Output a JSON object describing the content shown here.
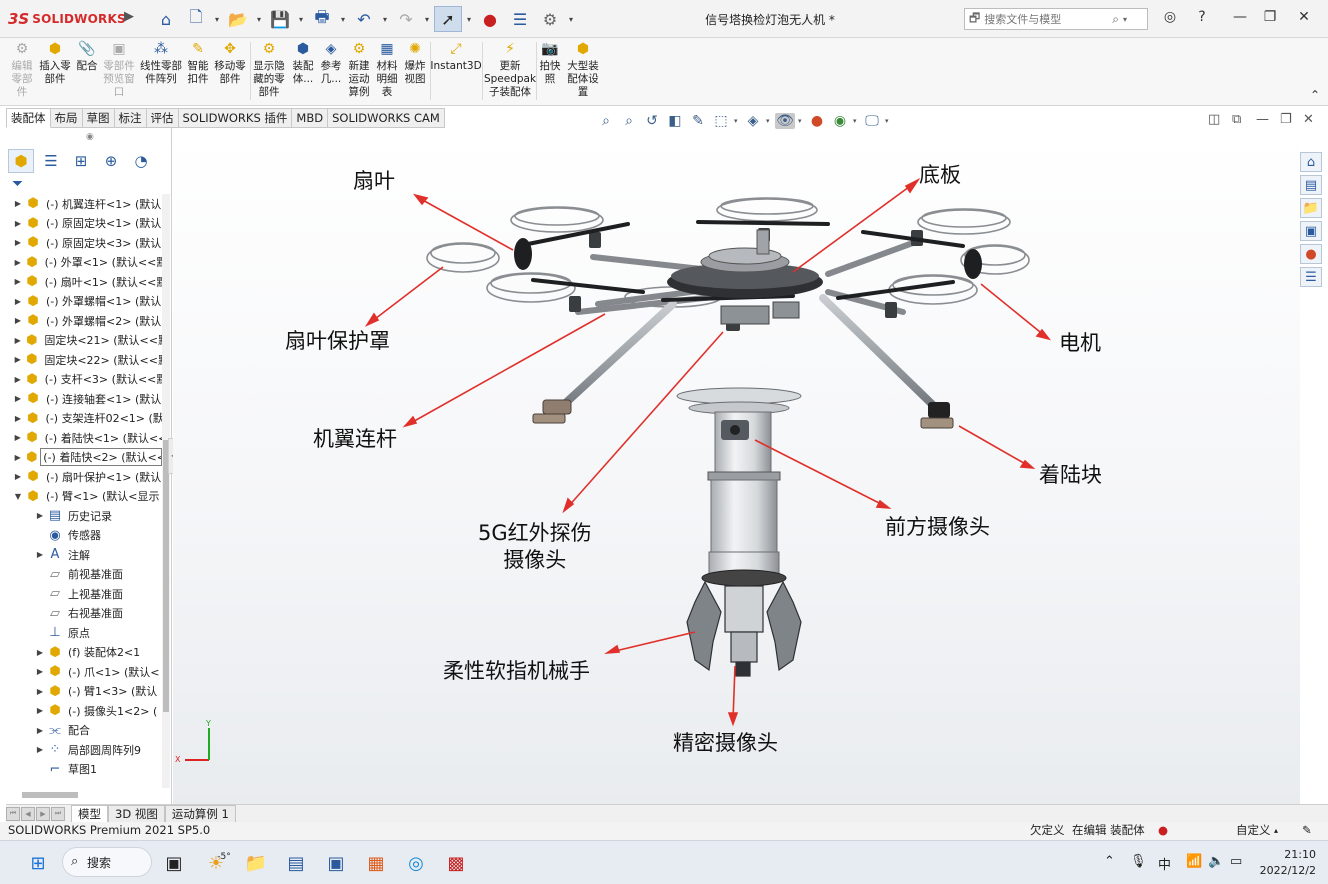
{
  "app": {
    "logo_mark": "3S",
    "logo_text": "SOLIDWORKS",
    "window_title": "信号塔换检灯泡无人机 *",
    "search_placeholder": "搜索文件与模型"
  },
  "ribbon": [
    {
      "label": "编辑\n零部\n件",
      "icon": "edit-component-icon",
      "disabled": true
    },
    {
      "label": "插入零\n部件",
      "icon": "insert-component-icon",
      "disabled": false
    },
    {
      "label": "配合",
      "icon": "mate-icon",
      "disabled": false
    },
    {
      "label": "零部件\n预览窗\n口",
      "icon": "component-preview-icon",
      "disabled": true
    },
    {
      "label": "线性零部\n件阵列",
      "icon": "linear-pattern-icon",
      "disabled": false
    },
    {
      "label": "智能\n扣件",
      "icon": "smart-fasteners-icon",
      "disabled": false
    },
    {
      "label": "移动零\n部件",
      "icon": "move-component-icon",
      "disabled": false
    },
    {
      "label": "显示隐\n藏的零\n部件",
      "icon": "show-hidden-icon",
      "disabled": false
    },
    {
      "label": "装配\n体...",
      "icon": "assembly-features-icon",
      "disabled": false
    },
    {
      "label": "参考\n几...",
      "icon": "reference-geometry-icon",
      "disabled": false
    },
    {
      "label": "新建\n运动\n算例",
      "icon": "new-motion-study-icon",
      "disabled": false
    },
    {
      "label": "材料\n明细\n表",
      "icon": "bom-icon",
      "disabled": false
    },
    {
      "label": "爆炸\n视图",
      "icon": "exploded-view-icon",
      "disabled": false
    },
    {
      "label": "Instant3D",
      "icon": "instant3d-icon",
      "disabled": false
    },
    {
      "label": "更新\nSpeedpak\n子装配体",
      "icon": "speedpak-icon",
      "disabled": false
    },
    {
      "label": "拍快\n照",
      "icon": "snapshot-icon",
      "disabled": false
    },
    {
      "label": "大型装\n配体设\n置",
      "icon": "large-assembly-icon",
      "disabled": false
    }
  ],
  "cm_tabs": [
    "装配体",
    "布局",
    "草图",
    "标注",
    "评估",
    "SOLIDWORKS 插件",
    "MBD",
    "SOLIDWORKS CAM"
  ],
  "tree": [
    {
      "label": "(-) 机翼连杆<1> (默认",
      "icon": "part",
      "expand": true,
      "indent": 0,
      "boxed": false
    },
    {
      "label": "(-) 原固定块<1> (默认",
      "icon": "part",
      "expand": true,
      "indent": 0,
      "boxed": false
    },
    {
      "label": "(-) 原固定块<3> (默认",
      "icon": "part",
      "expand": true,
      "indent": 0,
      "boxed": false
    },
    {
      "label": "(-) 外罩<1> (默认<<默",
      "icon": "part",
      "expand": true,
      "indent": 0,
      "boxed": false
    },
    {
      "label": "(-) 扇叶<1> (默认<<默",
      "icon": "part",
      "expand": true,
      "indent": 0,
      "boxed": false
    },
    {
      "label": "(-) 外罩螺帽<1> (默认",
      "icon": "part",
      "expand": true,
      "indent": 0,
      "boxed": false
    },
    {
      "label": "(-) 外罩螺帽<2> (默认",
      "icon": "part",
      "expand": true,
      "indent": 0,
      "boxed": false
    },
    {
      "label": "固定块<21> (默认<<默",
      "icon": "part",
      "expand": true,
      "indent": 0,
      "boxed": false
    },
    {
      "label": "固定块<22> (默认<<默",
      "icon": "part",
      "expand": true,
      "indent": 0,
      "boxed": false
    },
    {
      "label": "(-) 支杆<3> (默认<<默",
      "icon": "part",
      "expand": true,
      "indent": 0,
      "boxed": false
    },
    {
      "label": "(-) 连接轴套<1> (默认",
      "icon": "part",
      "expand": true,
      "indent": 0,
      "boxed": false
    },
    {
      "label": "(-) 支架连杆02<1> (默",
      "icon": "part",
      "expand": true,
      "indent": 0,
      "boxed": false
    },
    {
      "label": "(-) 着陆快<1> (默认<<",
      "icon": "part",
      "expand": true,
      "indent": 0,
      "boxed": false
    },
    {
      "label": "(-) 着陆快<2> (默认<<",
      "icon": "part",
      "expand": true,
      "indent": 0,
      "boxed": true
    },
    {
      "label": "(-) 扇叶保护<1> (默认",
      "icon": "part",
      "expand": true,
      "indent": 0,
      "boxed": false
    },
    {
      "label": "(-) 臂<1> (默认<显示",
      "icon": "asm",
      "expand": "open",
      "indent": 0,
      "boxed": false
    },
    {
      "label": "历史记录",
      "icon": "history",
      "expand": true,
      "indent": 1,
      "boxed": false
    },
    {
      "label": "传感器",
      "icon": "sensor",
      "expand": false,
      "indent": 1,
      "boxed": false
    },
    {
      "label": "注解",
      "icon": "annotation",
      "expand": true,
      "indent": 1,
      "boxed": false
    },
    {
      "label": "前视基准面",
      "icon": "plane",
      "expand": false,
      "indent": 1,
      "boxed": false
    },
    {
      "label": "上视基准面",
      "icon": "plane",
      "expand": false,
      "indent": 1,
      "boxed": false
    },
    {
      "label": "右视基准面",
      "icon": "plane",
      "expand": false,
      "indent": 1,
      "boxed": false
    },
    {
      "label": "原点",
      "icon": "origin",
      "expand": false,
      "indent": 1,
      "boxed": false
    },
    {
      "label": "(f) 装配体2<1",
      "icon": "asm",
      "expand": true,
      "indent": 1,
      "boxed": false
    },
    {
      "label": "(-) 爪<1> (默认<",
      "icon": "part",
      "expand": true,
      "indent": 1,
      "boxed": false
    },
    {
      "label": "(-) 臂1<3> (默认",
      "icon": "part",
      "expand": true,
      "indent": 1,
      "boxed": false
    },
    {
      "label": "(-) 摄像头1<2> (",
      "icon": "part",
      "expand": true,
      "indent": 1,
      "boxed": false
    },
    {
      "label": "配合",
      "icon": "mates",
      "expand": true,
      "indent": 1,
      "boxed": false
    },
    {
      "label": "局部圆周阵列9",
      "icon": "pattern",
      "expand": true,
      "indent": 1,
      "boxed": false
    },
    {
      "label": "草图1",
      "icon": "sketch",
      "expand": false,
      "indent": 1,
      "boxed": false
    }
  ],
  "labels": [
    {
      "key": "fan",
      "text": "扇叶"
    },
    {
      "key": "base",
      "text": "底板"
    },
    {
      "key": "guard",
      "text": "扇叶保护罩"
    },
    {
      "key": "motor",
      "text": "电机"
    },
    {
      "key": "arm",
      "text": "机翼连杆"
    },
    {
      "key": "landing",
      "text": "着陆块"
    },
    {
      "key": "cam5g",
      "text": "5G红外探伤\n摄像头"
    },
    {
      "key": "front_cam",
      "text": "前方摄像头"
    },
    {
      "key": "gripper",
      "text": "柔性软指机械手"
    },
    {
      "key": "precision_cam",
      "text": "精密摄像头"
    }
  ],
  "bottom_tabs": [
    "模型",
    "3D 视图",
    "运动算例 1"
  ],
  "status": {
    "product": "SOLIDWORKS Premium 2021 SP5.0",
    "defined": "欠定义",
    "editing": "在编辑 装配体",
    "units": "自定义"
  },
  "taskbar": {
    "search_label": "搜索",
    "weather": "-5°",
    "ime": "中",
    "time": "21:10",
    "date": "2022/12/2"
  },
  "colors": {
    "annotation_arrow": "#e0302b",
    "brand": "#d52a2a",
    "part_icon": "#e0a800"
  }
}
